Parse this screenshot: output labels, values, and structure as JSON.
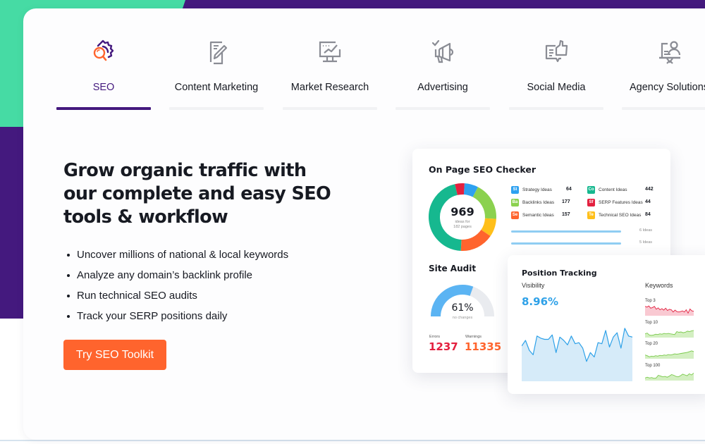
{
  "colors": {
    "brand_purple": "#44197e",
    "brand_green": "#46dba4",
    "cta_orange": "#ff642d",
    "visibility_blue": "#2ea1e8",
    "errors_red": "#e3203f",
    "warnings_orange": "#ff642d"
  },
  "tabs": [
    {
      "label": "SEO",
      "icon": "seo-gear-magnifier-icon",
      "active": true
    },
    {
      "label": "Content Marketing",
      "icon": "document-pencil-icon",
      "active": false
    },
    {
      "label": "Market Research",
      "icon": "monitor-chart-icon",
      "active": false
    },
    {
      "label": "Advertising",
      "icon": "megaphone-icon",
      "active": false
    },
    {
      "label": "Social Media",
      "icon": "chat-thumbs-up-icon",
      "active": false
    },
    {
      "label": "Agency Solutions",
      "icon": "presentation-person-icon",
      "active": false
    }
  ],
  "hero": {
    "title_lines": [
      "Grow organic traffic with",
      "our complete and easy SEO",
      "tools & workflow"
    ],
    "bullets": [
      "Uncover millions of national & local keywords",
      "Analyze any domain’s backlink profile",
      "Run technical SEO audits",
      "Track your SERP positions daily"
    ],
    "cta_label": "Try SEO Toolkit"
  },
  "on_page_checker": {
    "title": "On Page SEO Checker",
    "total": "969",
    "total_caption_1": "ideas for",
    "total_caption_2": "182 pages",
    "ideas": [
      {
        "abbr": "St",
        "label": "Strategy Ideas",
        "value": "64",
        "color": "#2ea1f0"
      },
      {
        "abbr": "Ba",
        "label": "Backlinks Ideas",
        "value": "177",
        "color": "#8bd14f"
      },
      {
        "abbr": "Se",
        "label": "Semantic Ideas",
        "value": "157",
        "color": "#ff642d"
      },
      {
        "abbr": "Co",
        "label": "Content Ideas",
        "value": "442",
        "color": "#16b88f"
      },
      {
        "abbr": "Sf",
        "label": "SERP Features Ideas",
        "value": "44",
        "color": "#e3203f"
      },
      {
        "abbr": "Te",
        "label": "Technical SEO Ideas",
        "value": "84",
        "color": "#ffbf1a"
      }
    ],
    "page_bars": [
      {
        "label": "6 Ideas"
      },
      {
        "label": "5 Ideas"
      }
    ]
  },
  "site_audit": {
    "title": "Site Audit",
    "percent": 61,
    "percent_label": "61%",
    "caption": "no changes",
    "errors_label": "Errors",
    "errors_value": "1237",
    "warnings_label": "Warnings",
    "warnings_value": "11335"
  },
  "position_tracking": {
    "title": "Position Tracking",
    "visibility_label": "Visibility",
    "visibility_value": "8.96%",
    "keywords_label": "Keywords",
    "visibility_series": [
      52,
      57,
      48,
      44,
      61,
      59,
      58,
      58,
      62,
      46,
      60,
      57,
      53,
      61,
      54,
      55,
      50,
      38,
      46,
      42,
      55,
      54,
      66,
      51,
      60,
      64,
      50,
      68,
      61,
      60
    ],
    "keyword_groups": [
      {
        "label": "Top 3",
        "color": "#e3203f",
        "fill": "#f9c9d2",
        "series": [
          70,
          66,
          72,
          60,
          64,
          70,
          55,
          62,
          52,
          58,
          50,
          60,
          48,
          54,
          52,
          40,
          50,
          42,
          40,
          42,
          46,
          40,
          52,
          34,
          56,
          46,
          44
        ]
      },
      {
        "label": "Top 10",
        "color": "#79c94a",
        "fill": "#d3efc1",
        "series": [
          40,
          44,
          34,
          32,
          34,
          38,
          36,
          40,
          38,
          42,
          40,
          42,
          40,
          38,
          36,
          52,
          48,
          50,
          46,
          48,
          54,
          52,
          56,
          58
        ]
      },
      {
        "label": "Top 20",
        "color": "#79c94a",
        "fill": "#d3efc1",
        "series": [
          40,
          36,
          30,
          34,
          32,
          36,
          34,
          38,
          36,
          40,
          38,
          42,
          40,
          42,
          46,
          44,
          46,
          48,
          50,
          52,
          54,
          58,
          62,
          58
        ]
      },
      {
        "label": "Top 100",
        "color": "#79c94a",
        "fill": "#d3efc1",
        "series": [
          34,
          38,
          34,
          36,
          32,
          34,
          48,
          44,
          40,
          42,
          38,
          44,
          52,
          48,
          42,
          40,
          46,
          54,
          50,
          46,
          56,
          50,
          60
        ]
      }
    ]
  }
}
